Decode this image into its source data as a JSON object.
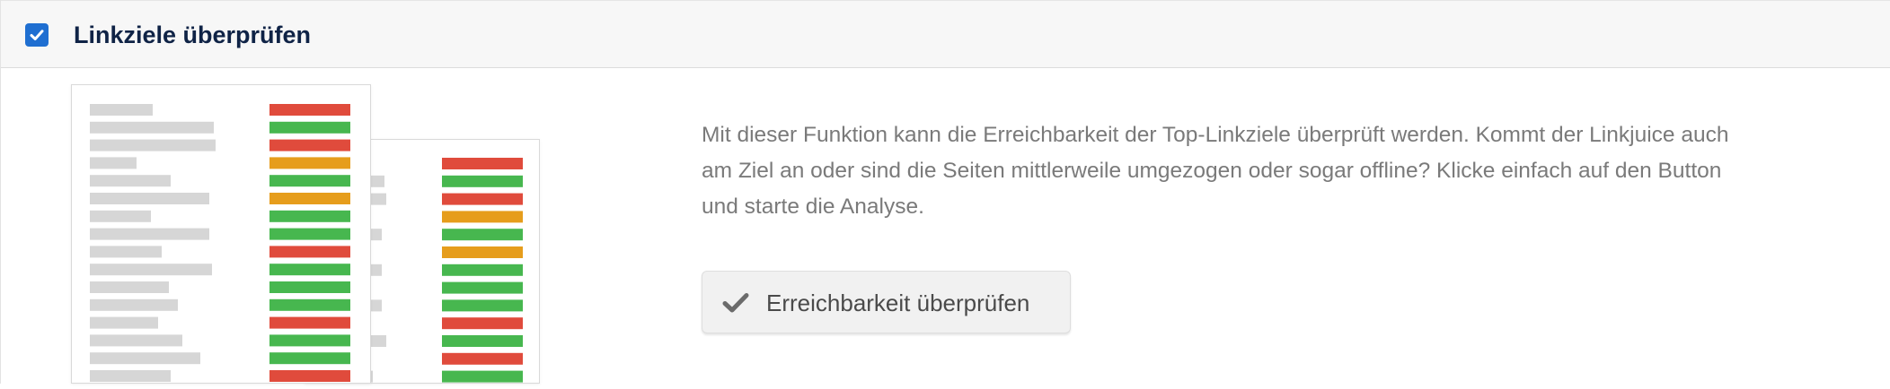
{
  "header": {
    "checkbox_checked": true,
    "title": "Linkziele überprüfen"
  },
  "description": {
    "lines": [
      "Mit dieser Funktion kann die Erreichbarkeit der Top-Linkziele überprüft werden. Kommt der Linkjuice auch",
      "am Ziel an oder sind die Seiten mittlerweile umgezogen oder sogar offline? Klicke einfach auf den Button",
      "und starte die Analyse."
    ]
  },
  "button": {
    "label": "Erreichbarkeit überprüfen",
    "icon": "checkmark-icon"
  },
  "illustration": {
    "front_sheet_status": [
      "red",
      "green",
      "red",
      "orange",
      "green",
      "orange",
      "green",
      "green",
      "red",
      "green",
      "green",
      "green",
      "red",
      "green",
      "green",
      "red"
    ],
    "back_sheet_status": [
      "red",
      "green",
      "red",
      "orange",
      "green",
      "orange",
      "green",
      "green",
      "green",
      "red",
      "green",
      "red",
      "green",
      "red"
    ]
  },
  "colors": {
    "checkbox_blue": "#1f6fd1",
    "title_navy": "#0f2346",
    "status_red": "#e04b3c",
    "status_green": "#47b74f",
    "status_orange": "#e69d1c",
    "placeholder_gray": "#d6d6d6"
  }
}
